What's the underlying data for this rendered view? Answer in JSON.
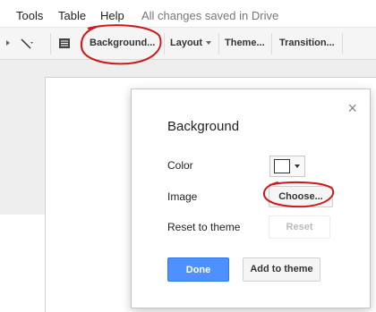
{
  "menubar": {
    "items": [
      "Tools",
      "Table",
      "Help"
    ],
    "save_status": "All changes saved in Drive"
  },
  "toolbar": {
    "background_label": "Background...",
    "layout_label": "Layout",
    "theme_label": "Theme...",
    "transition_label": "Transition..."
  },
  "dialog": {
    "title": "Background",
    "close_glyph": "×",
    "color_label": "Color",
    "selected_color": "#ffffff",
    "image_label": "Image",
    "choose_label": "Choose...",
    "reset_label": "Reset to theme",
    "reset_button": "Reset",
    "done_label": "Done",
    "add_theme_label": "Add to theme"
  },
  "colors": {
    "primary_button": "#4d90fe",
    "annotation": "#cc1a1a"
  }
}
